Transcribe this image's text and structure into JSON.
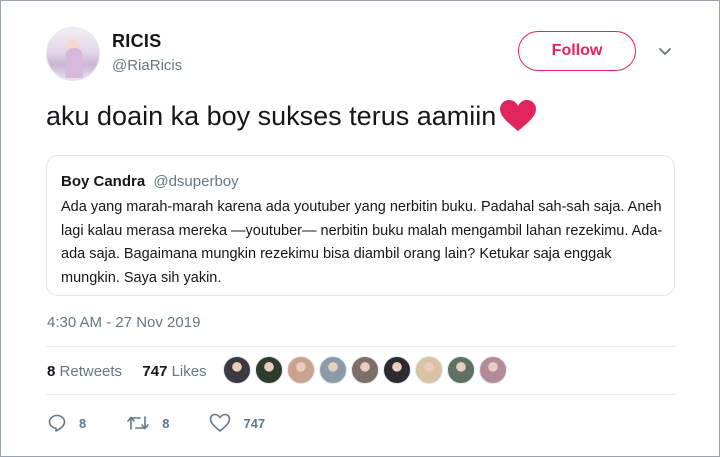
{
  "tweet": {
    "author_name": "RICIS",
    "author_handle": "@RiaRicis",
    "follow_label": "Follow",
    "text": "aku doain ka boy sukses terus aamiin",
    "timestamp": "4:30 AM - 27 Nov 2019"
  },
  "quoted_tweet": {
    "author_name": "Boy Candra",
    "author_handle": "@dsuperboy",
    "text": "Ada yang marah-marah karena ada youtuber yang nerbitin buku. Padahal sah-sah saja. Aneh lagi kalau merasa mereka —youtuber— nerbitin buku malah mengambil lahan rezekimu. Ada-ada saja. Bagaimana mungkin rezekimu bisa diambil orang lain? Ketukar saja enggak mungkin. Saya sih yakin."
  },
  "stats": {
    "retweets_count": "8",
    "retweets_label": "Retweets",
    "likes_count": "747",
    "likes_label": "Likes"
  },
  "actions": {
    "reply_count": "8",
    "retweet_count": "8",
    "like_count": "747"
  },
  "likers": [
    {
      "color": "#3b3a40"
    },
    {
      "color": "#2f3b2c"
    },
    {
      "color": "#c9a38f"
    },
    {
      "color": "#8b9aa8"
    },
    {
      "color": "#7d6e68"
    },
    {
      "color": "#2b2a2e"
    },
    {
      "color": "#d9c2a6"
    },
    {
      "color": "#5f6f63"
    },
    {
      "color": "#b48a9a"
    }
  ],
  "colors": {
    "accent": "#e0245e",
    "secondary_text": "#657786",
    "heart": "#e0245e"
  },
  "icons": {
    "caret": "chevron-down-icon",
    "reply": "reply-icon",
    "retweet": "retweet-icon",
    "like": "heart-outline-icon",
    "emoji": "red-heart-emoji-icon"
  }
}
